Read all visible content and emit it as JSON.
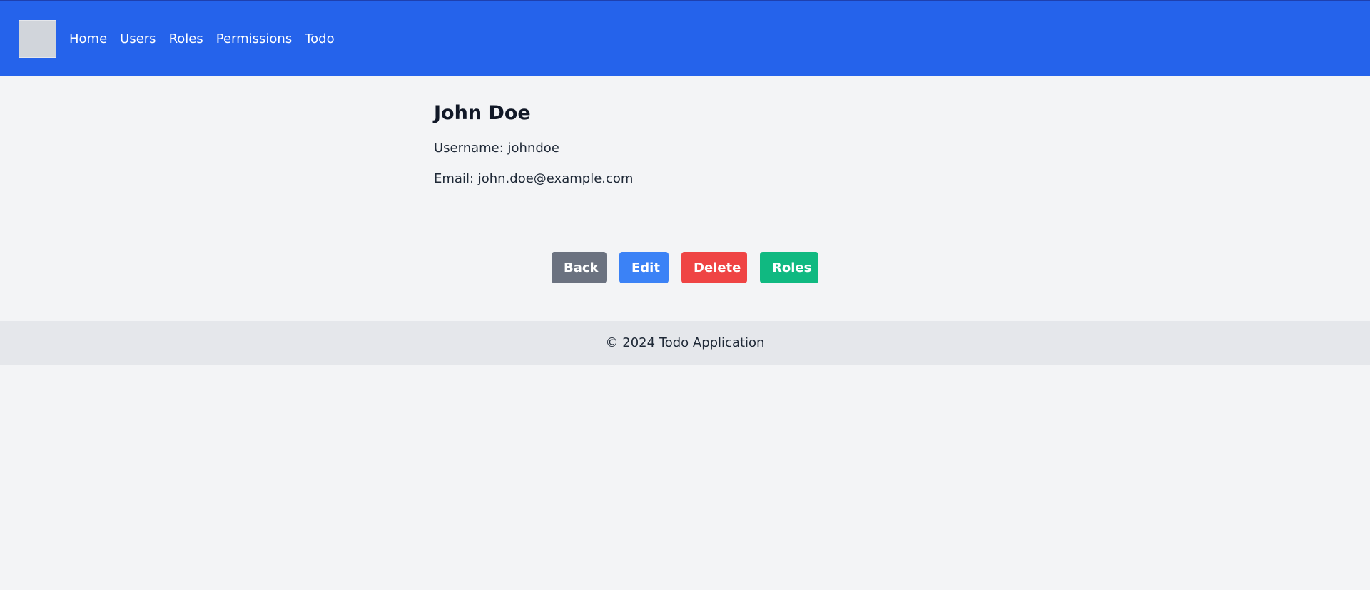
{
  "navbar": {
    "logo_icon": "logo-placeholder",
    "links": [
      {
        "label": "Home"
      },
      {
        "label": "Users"
      },
      {
        "label": "Roles"
      },
      {
        "label": "Permissions"
      },
      {
        "label": "Todo"
      }
    ],
    "background": "#2563eb"
  },
  "user": {
    "name": "John Doe",
    "username_line": "Username: johndoe",
    "email_line": "Email: john.doe@example.com"
  },
  "actions": {
    "back_label": "Back",
    "edit_label": "Edit",
    "delete_label": "Delete",
    "roles_label": "Roles",
    "colors": {
      "back": "#6b7280",
      "edit": "#3b82f6",
      "delete": "#ef4444",
      "roles": "#10b981"
    }
  },
  "footer": {
    "text": "© 2024 Todo Application"
  }
}
